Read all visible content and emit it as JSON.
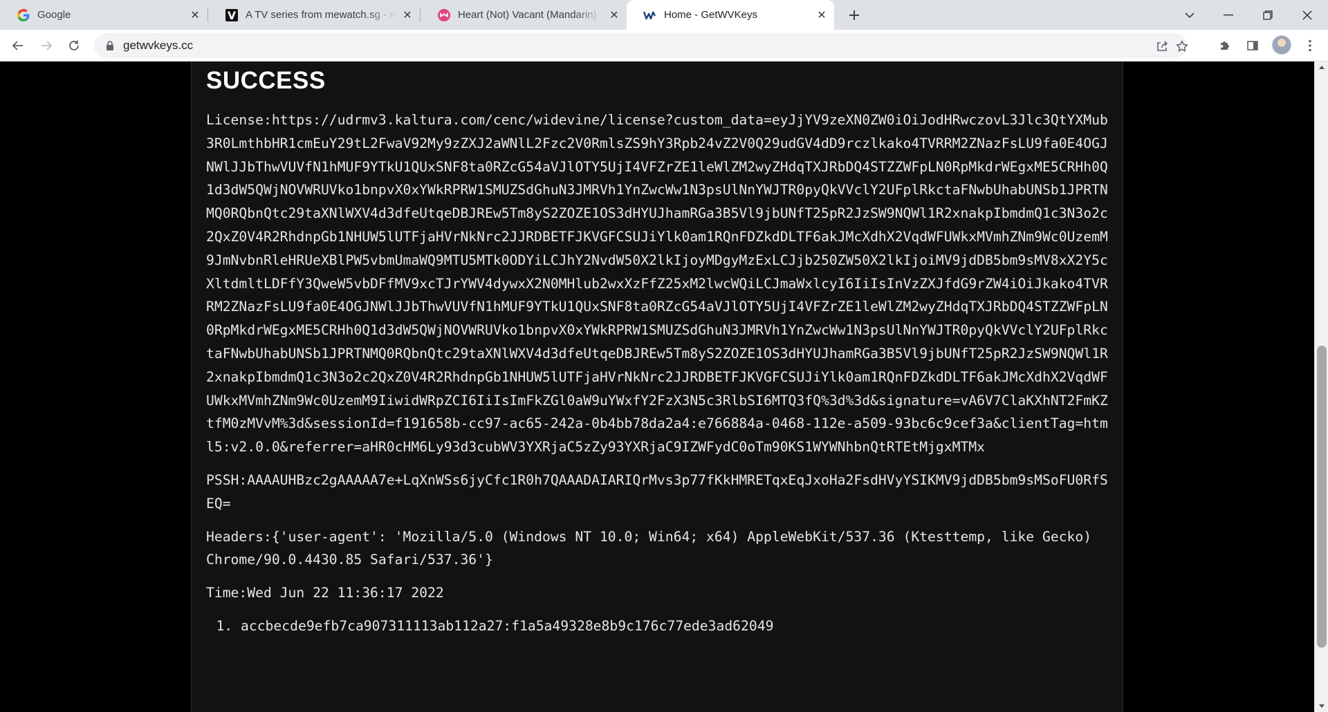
{
  "tabs": [
    {
      "title": "Google",
      "favicon": "google-logo-icon",
      "active": false
    },
    {
      "title": "A TV series from mewatch.sg - mewatch",
      "favicon": "mewatch-logo-icon",
      "active": false
    },
    {
      "title": "Heart (Not) Vacant (Mandarin)",
      "favicon": "mewatch-pink-logo-icon",
      "active": false
    },
    {
      "title": "Home - GetWVKeys",
      "favicon": "getwvkeys-logo-icon",
      "active": true
    }
  ],
  "address_bar": {
    "url": "getwvkeys.cc"
  },
  "colors": {
    "page_background": "#121212",
    "text": "#e6e6e6",
    "tab_strip": "#dee1e6",
    "omnibox": "#f1f3f4"
  },
  "result": {
    "heading": "SUCCESS",
    "license": "License:https://udrmv3.kaltura.com/cenc/widevine/license?custom_data=eyJjYV9zeXN0ZW0iOiJodHRwczovL3Jlc3QtYXMub3R0LmthbHR1cmEuY29tL2FwaV92My9zZXJ2aWNlL2Fzc2V0RmlsZS9hY3Rpb24vZ2V0Q29udGV4dD9rczlkako4TVRRM2ZNazFsLU9fa0E4OGJNWlJJbThwVUVfN1hMUF9YTkU1QUxSNF8ta0RZcG54aVJlOTY5UjI4VFZrZE1leWlZM2wyZHdqTXJRbDQ4STZZWFpLN0RpMkdrWEgxME5CRHh0Q1d3dW5QWjNOVWRUVko1bnpvX0xYWkRPRW1SMUZSdGhuN3JMRVh1YnZwcWw1N3psUlNnYWJTR0pyQkVVclY2UFplRkctaFNwbUhabUNSb1JPRTNMQ0RQbnQtc29taXNlWXV4d3dfeUtqeDBJREw5Tm8yS2ZOZE1OS3dHYUJhamRGa3B5Vl9jbUNfT25pR2JzSW9NQWl1R2xnakpIbmdmQ1c3N3o2c2QxZ0V4R2RhdnpGb1NHUW5lUTFjaHVrNkNrc2JJRDBETFJKVGFCSUJiYlk0am1RQnFDZkdDLTF6akJMcXdhX2VqdWFUWkxMVmhZNm9Wc0UzemM9JmNvbnRleHRUeXBlPW5vbmUmaWQ9MTU5MTk0ODYiLCJhY2NvdW50X2lkIjoyMDgyMzExLCJjb250ZW50X2lkIjoiMV9jdDB5bm9sMV8xX2Y5cXltdmltLDFfY3QweW5vbDFfMV9xcTJrYWV4dywxX2N0MHlub2wxXzFfZ25xM2lwcWQiLCJmaWxlcyI6IiIsInVzZXJfdG9rZW4iOiJkako4TVRRM2ZNazFsLU9fa0E4OGJNWlJJbThwVUVfN1hMUF9YTkU1QUxSNF8ta0RZcG54aVJlOTY5UjI4VFZrZE1leWlZM2wyZHdqTXJRbDQ4STZZWFpLN0RpMkdrWEgxME5CRHh0Q1d3dW5QWjNOVWRUVko1bnpvX0xYWkRPRW1SMUZSdGhuN3JMRVh1YnZwcWw1N3psUlNnYWJTR0pyQkVVclY2UFplRkctaFNwbUhabUNSb1JPRTNMQ0RQbnQtc29taXNlWXV4d3dfeUtqeDBJREw5Tm8yS2ZOZE1OS3dHYUJhamRGa3B5Vl9jbUNfT25pR2JzSW9NQWl1R2xnakpIbmdmQ1c3N3o2c2QxZ0V4R2RhdnpGb1NHUW5lUTFjaHVrNkNrc2JJRDBETFJKVGFCSUJiYlk0am1RQnFDZkdDLTF6akJMcXdhX2VqdWFUWkxMVmhZNm9Wc0UzemM9IiwidWRpZCI6IiIsImFkZGl0aW9uYWxfY2FzX3N5c3RlbSI6MTQ3fQ%3d%3d&signature=vA6V7ClaKXhNT2FmKZtfM0zMVvM%3d&sessionId=f191658b-cc97-ac65-242a-0b4bb78da2a4:e766884a-0468-112e-a509-93bc6c9cef3a&clientTag=html5:v2.0.0&referrer=aHR0cHM6Ly93d3cubWV3YXRjaC5zZy93YXRjaC9IZWFydC0oTm90KS1WYWNhbnQtRTEtMjgxMTMx",
    "pssh": "PSSH:AAAAUHBzc2gAAAAA7e+LqXnWSs6jyCfc1R0h7QAAADAIARIQrMvs3p77fKkHMRETqxEqJxoHa2FsdHVyYSIKMV9jdDB5bm9sMSoFU0RfSEQ=",
    "headers": "Headers:{'user-agent': 'Mozilla/5.0 (Windows NT 10.0; Win64; x64) AppleWebKit/537.36 (Ktesttemp, like Gecko) Chrome/90.0.4430.85 Safari/537.36'}",
    "time": "Time:Wed Jun 22 11:36:17 2022",
    "keys": [
      "accbecde9efb7ca907311113ab112a27:f1a5a49328e8b9c176c77ede3ad62049"
    ]
  }
}
